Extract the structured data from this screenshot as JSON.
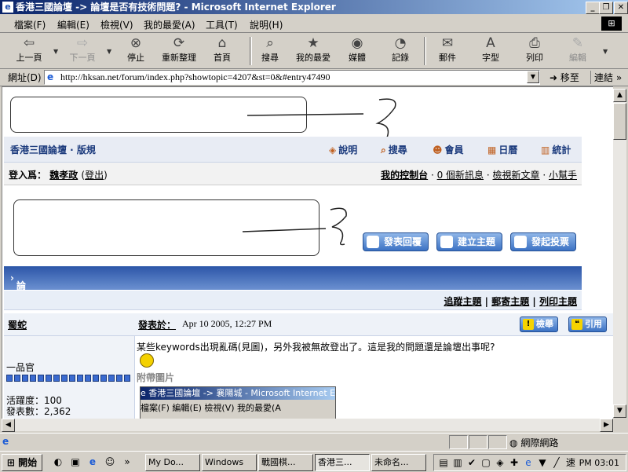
{
  "window": {
    "title": "香港三國論壇 -> 論壇是否有技術問題? - Microsoft Internet Explorer",
    "minimize_icon": "_",
    "restore_icon": "❐",
    "close_icon": "✕"
  },
  "menu": [
    "檔案(F)",
    "編輯(E)",
    "檢視(V)",
    "我的最愛(A)",
    "工具(T)",
    "說明(H)"
  ],
  "toolbar": {
    "back": "上一頁",
    "forward": "下一頁",
    "stop": "停止",
    "refresh": "重新整理",
    "home": "首頁",
    "search": "搜尋",
    "favorites": "我的最愛",
    "media": "媒體",
    "history": "記錄",
    "mail": "郵件",
    "font": "字型",
    "print": "列印",
    "edit": "編輯"
  },
  "address": {
    "label": "網址(D)",
    "url": "http://hksan.net/forum/index.php?showtopic=4207&st=0&#entry47490",
    "go": "移至",
    "links": "連結"
  },
  "forum": {
    "brand": "香港三國論壇 · 版規",
    "nav": {
      "help": "說明",
      "search": "搜尋",
      "members": "會員",
      "calendar": "日曆",
      "stats": "統計"
    },
    "login_label": "登入爲：",
    "username": "魏孝政",
    "logout": "登出",
    "control_panel": "我的控制台",
    "new_messages": "0 個新訊息",
    "view_new": "檢視新文章",
    "helper": "小幫手",
    "buttons": {
      "reply": "發表回覆",
      "new_topic": "建立主題",
      "poll": "發起投票"
    },
    "topic_title": "論壇是否有技術問題?",
    "options": {
      "track": "追蹤主題",
      "email": "郵寄主題",
      "print": "列印主題"
    },
    "post": {
      "author": "蜀蛇",
      "posted_on": "發表於：",
      "date": "Apr 10 2005, 12:27 PM",
      "report": "檢舉",
      "quote": "引用",
      "body": "某些keywords出現亂碼(見圖)，另外我被無故登出了。這是我的問題還是論壇出事呢?",
      "rank": "一品官",
      "pips": 16,
      "activity": "活躍度：100",
      "posts": "發表數：2,362",
      "attachment_label": "附帶圖片",
      "thumb_title": "香港三國論壇 -> 襄陽城 - Microsoft Internet E",
      "thumb_menu": "檔案(F)  編輯(E)  檢視(V)  我的最愛(A"
    }
  },
  "status": {
    "zone": "網際網路"
  },
  "taskbar": {
    "start": "開始",
    "items": [
      "My Do...",
      "Windows",
      "戰國棋...",
      "香港三...",
      "未命名..."
    ],
    "time": "PM 03:01"
  }
}
